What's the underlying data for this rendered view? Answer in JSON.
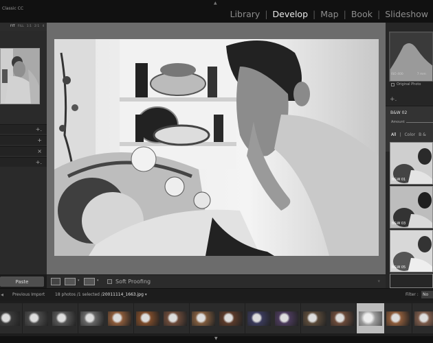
{
  "app": {
    "title": "Classic CC"
  },
  "modules": [
    {
      "label": "Library",
      "active": false
    },
    {
      "label": "Develop",
      "active": true
    },
    {
      "label": "Map",
      "active": false
    },
    {
      "label": "Book",
      "active": false
    },
    {
      "label": "Slideshow",
      "active": false
    }
  ],
  "navigator": {
    "zoom_options": [
      "FIT",
      "FILL",
      "1:1",
      "2:1"
    ],
    "selected_zoom": "FIT"
  },
  "left_panel": {
    "sections": [
      {
        "control": "+."
      },
      {
        "control": "+"
      },
      {
        "control": "+"
      },
      {
        "control": "×"
      },
      {
        "control": "+."
      }
    ],
    "paste_label": "Paste"
  },
  "toolbar": {
    "soft_proofing_label": "Soft Proofing"
  },
  "histogram": {
    "iso": "ISO 400",
    "focal": "7 mm",
    "original_photo_label": "Original Photo"
  },
  "presets": {
    "plus": "+.",
    "current": "B&W 02",
    "amount_label": "Amount",
    "filters": [
      "All",
      "Color",
      "B &"
    ],
    "active_filter": "All",
    "thumbnails": [
      {
        "label": "B&W 01"
      },
      {
        "label": "B&W 03"
      },
      {
        "label": "B&W 05"
      }
    ]
  },
  "filmstrip_bar": {
    "source": "Previous Import",
    "count": "18 photos /1 selected /",
    "filename": "20011114_1663.jpg",
    "filter_label": "Filter :",
    "filter_value": "No"
  },
  "filmstrip": {
    "count": 16,
    "selected_index": 13
  },
  "colors": {
    "accent": "#e9e9e9",
    "background": "#6c6c6c",
    "panel": "#2a2a2a"
  }
}
